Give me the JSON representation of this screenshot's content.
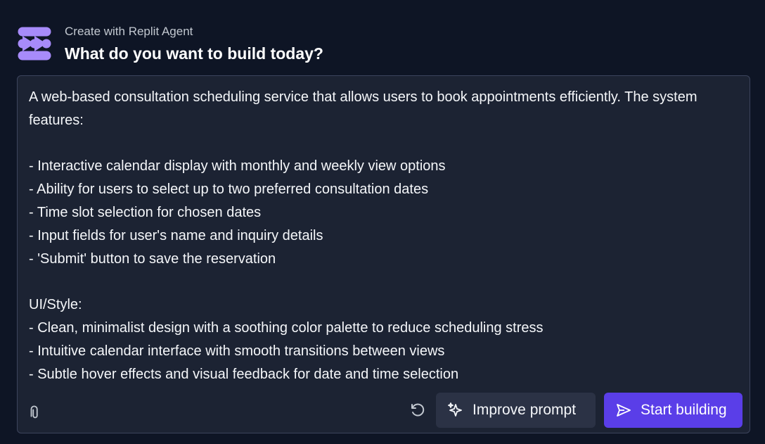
{
  "header": {
    "subtitle": "Create with Replit Agent",
    "title": "What do you want to build today?",
    "logo_icon": "replit-agent-logo",
    "logo_color": "#a78bfa"
  },
  "prompt": {
    "text": "A web-based consultation scheduling service that allows users to book appointments efficiently. The system features:\n\n- Interactive calendar display with monthly and weekly view options\n- Ability for users to select up to two preferred consultation dates\n- Time slot selection for chosen dates\n- Input fields for user's name and inquiry details\n- 'Submit' button to save the reservation\n\nUI/Style:\n- Clean, minimalist design with a soothing color palette to reduce scheduling stress\n- Intuitive calendar interface with smooth transitions between views\n- Subtle hover effects and visual feedback for date and time selection"
  },
  "toolbar": {
    "attach_icon": "paperclip-icon",
    "undo_icon": "undo-icon",
    "improve_icon": "sparkle-icon",
    "improve_label": "Improve prompt",
    "start_icon": "send-icon",
    "start_label": "Start building"
  },
  "colors": {
    "background": "#0e1525",
    "panel": "#1c2333",
    "accent": "#5a3ee8"
  }
}
